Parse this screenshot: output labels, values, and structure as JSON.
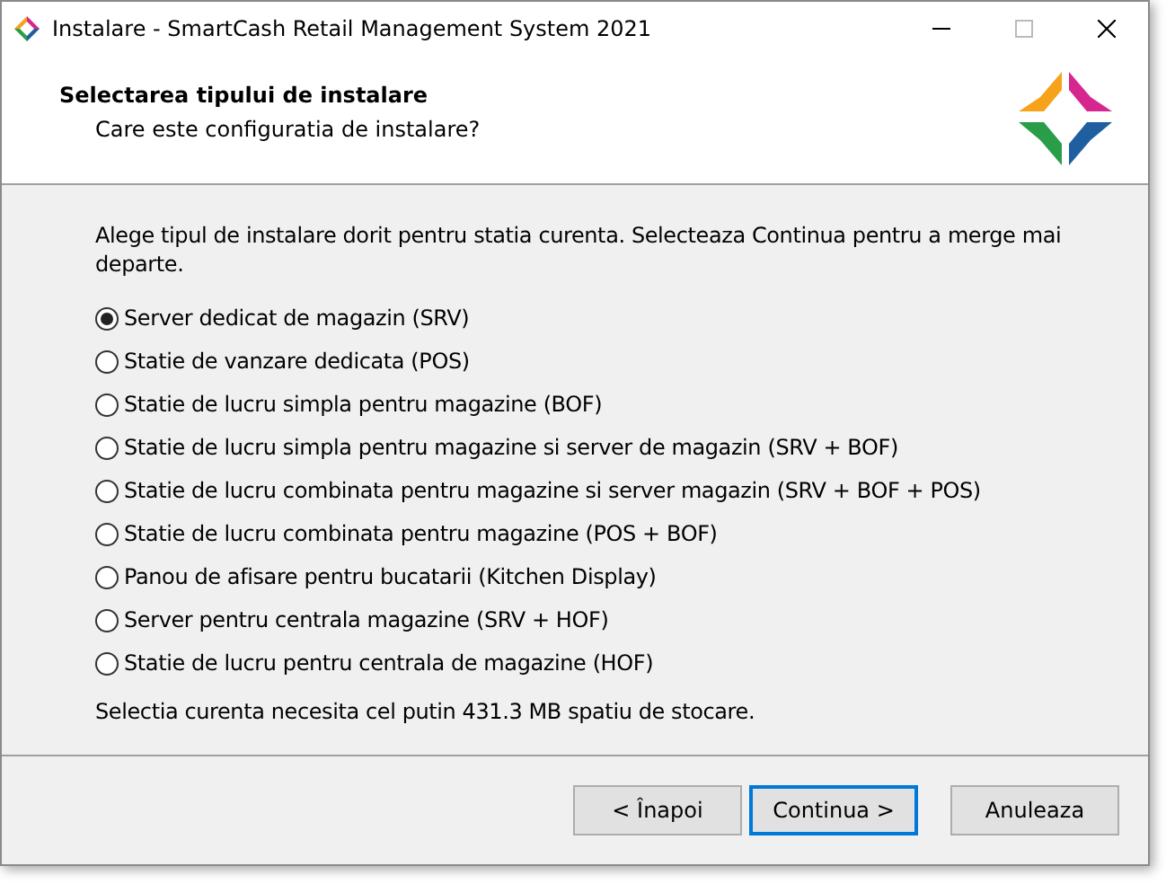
{
  "window": {
    "title": "Instalare - SmartCash Retail Management System 2021"
  },
  "header": {
    "title": "Selectarea tipului de instalare",
    "subtitle": "Care este configuratia de instalare?"
  },
  "intro": "Alege tipul de instalare dorit pentru statia curenta. Selecteaza Continua pentru a merge mai departe.",
  "options": [
    {
      "label": "Server dedicat de magazin (SRV)",
      "selected": true
    },
    {
      "label": "Statie de vanzare dedicata (POS)",
      "selected": false
    },
    {
      "label": "Statie de lucru simpla pentru magazine (BOF)",
      "selected": false
    },
    {
      "label": "Statie de lucru simpla pentru magazine si server de magazin (SRV + BOF)",
      "selected": false
    },
    {
      "label": "Statie de lucru combinata pentru magazine si server magazin (SRV + BOF + POS)",
      "selected": false
    },
    {
      "label": "Statie de lucru combinata pentru magazine (POS + BOF)",
      "selected": false
    },
    {
      "label": "Panou de afisare pentru bucatarii (Kitchen Display)",
      "selected": false
    },
    {
      "label": "Server pentru centrala magazine (SRV + HOF)",
      "selected": false
    },
    {
      "label": "Statie de lucru pentru centrala de magazine (HOF)",
      "selected": false
    }
  ],
  "storage_note": "Selectia curenta necesita cel putin 431.3 MB spatiu de stocare.",
  "buttons": [
    {
      "label": "< Înapoi",
      "kind": "back",
      "focused": false
    },
    {
      "label": "Continua >",
      "kind": "next",
      "focused": true
    },
    {
      "label": "Anuleaza",
      "kind": "cancel",
      "focused": false
    }
  ]
}
